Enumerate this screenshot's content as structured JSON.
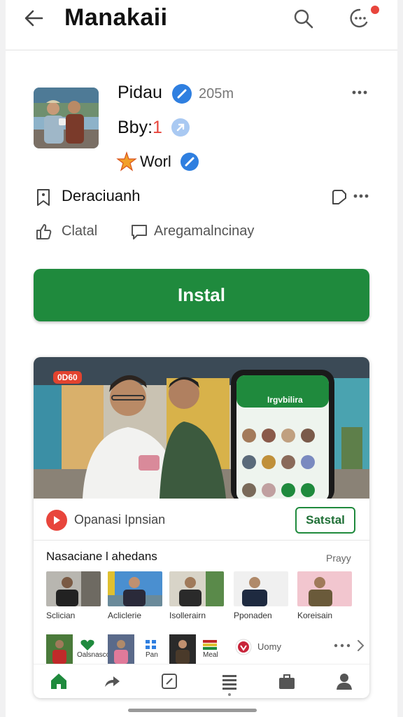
{
  "header": {
    "title": "Manakaii",
    "back_icon": "back-arrow-icon",
    "search_icon": "search-icon",
    "chat_icon": "chat-icon",
    "notification_color": "#e8453c"
  },
  "profile": {
    "name": "Pidau",
    "time": "205m",
    "bby_label": "Bby:",
    "bby_value": "1",
    "world_label": "Worl"
  },
  "section": {
    "title": "Deraciuanh",
    "like_label": "Clatal",
    "save_label": "Aregamalncinay"
  },
  "install": {
    "label": "Instal",
    "color": "#1f8a3d"
  },
  "card": {
    "hero_badge": "0D60",
    "phone_title": "Irgvbilira",
    "promo_label": "Opanasi Ipnsian",
    "promo_button": "Satstal",
    "list_title": "Nasaciane l ahedans",
    "list_more": "Prayy",
    "tiles": [
      {
        "label": "Sclician"
      },
      {
        "label": "Acliclerie"
      },
      {
        "label": "Isollerairn"
      },
      {
        "label": "Pponaden"
      },
      {
        "label": "Koreisain"
      }
    ],
    "minis": [
      {
        "label": "Oalsnasco"
      },
      {
        "label": "Pan"
      },
      {
        "label": "Meal"
      },
      {
        "label": "Uomy"
      }
    ]
  },
  "nav": {
    "items": [
      "home-icon",
      "share-icon",
      "edit-icon",
      "list-icon",
      "briefcase-icon",
      "profile-icon"
    ],
    "active_color": "#1f8a3d"
  }
}
